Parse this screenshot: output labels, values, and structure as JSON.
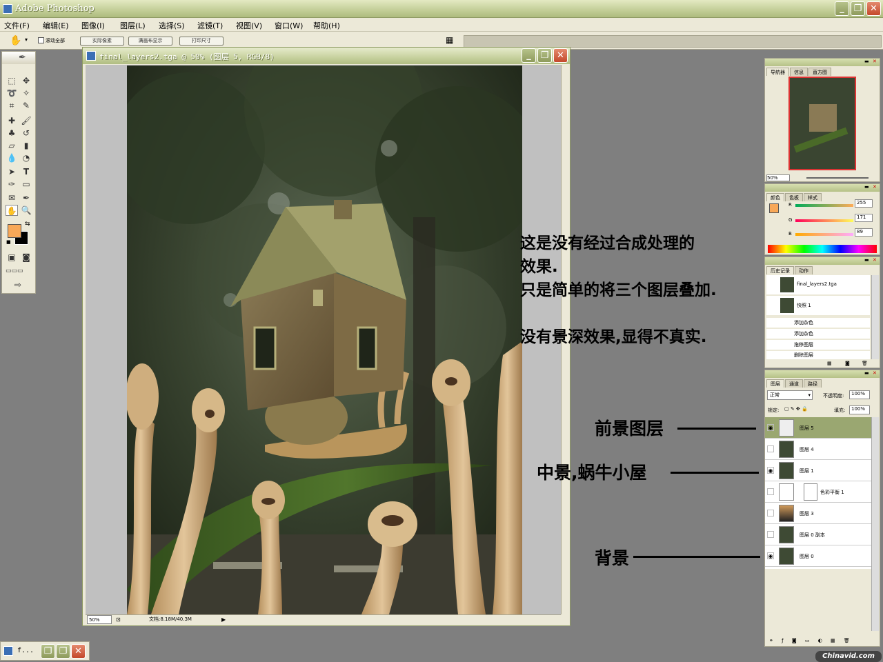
{
  "app": {
    "title": "Adobe Photoshop"
  },
  "window_controls": {
    "min": "_",
    "max": "❐",
    "close": "✕"
  },
  "menu": [
    "文件(F)",
    "编辑(E)",
    "图像(I)",
    "图层(L)",
    "选择(S)",
    "滤镜(T)",
    "视图(V)",
    "窗口(W)",
    "帮助(H)"
  ],
  "options": {
    "scroll_all": "滚动全部",
    "buttons": [
      "实际像素",
      "满画布显示",
      "打印尺寸"
    ]
  },
  "document": {
    "title": "final_layers2.tga @ 50% (图层 5, RGB/8)",
    "zoom": "50%",
    "doc_size": "文档:8.18M/40.3M"
  },
  "annotation": {
    "lines": [
      "这是没有经过合成处理的",
      "效果.",
      "只是简单的将三个图层叠加.",
      "",
      "没有景深效果,显得不真实."
    ]
  },
  "layer_labels": {
    "foreground": "前景图层",
    "midground": "中景,蜗牛小屋",
    "background": "背景"
  },
  "navigator": {
    "tabs": [
      "导航器",
      "信息",
      "直方图"
    ],
    "zoom": "50%"
  },
  "color": {
    "tabs": [
      "颜色",
      "色板",
      "样式"
    ],
    "channels": [
      {
        "name": "R",
        "value": "255"
      },
      {
        "name": "G",
        "value": "171"
      },
      {
        "name": "B",
        "value": "89"
      }
    ],
    "foreground": "#f8a858"
  },
  "history": {
    "tabs": [
      "历史记录",
      "动作"
    ],
    "snapshots": [
      "final_layers2.tga",
      "快照 1"
    ],
    "steps": [
      "添加杂色",
      "添加杂色",
      "拖移图层",
      "删除图层"
    ]
  },
  "layers": {
    "tabs": [
      "图层",
      "通道",
      "路径"
    ],
    "blend_mode": "正常",
    "opacity_label": "不透明度:",
    "opacity": "100%",
    "lock_label": "锁定:",
    "fill_label": "填充:",
    "fill": "100%",
    "items": [
      {
        "name": "图层 5",
        "visible": true,
        "selected": true
      },
      {
        "name": "图层 4",
        "visible": false,
        "selected": false
      },
      {
        "name": "图层 1",
        "visible": true,
        "selected": false
      },
      {
        "name": "色彩平衡 1",
        "visible": false,
        "selected": false
      },
      {
        "name": "图层 3",
        "visible": false,
        "selected": false
      },
      {
        "name": "图层 0 副本",
        "visible": false,
        "selected": false
      },
      {
        "name": "图层 0",
        "visible": true,
        "selected": false
      }
    ]
  },
  "taskbar": {
    "item": "f..."
  },
  "watermark": "Chinavid.com"
}
